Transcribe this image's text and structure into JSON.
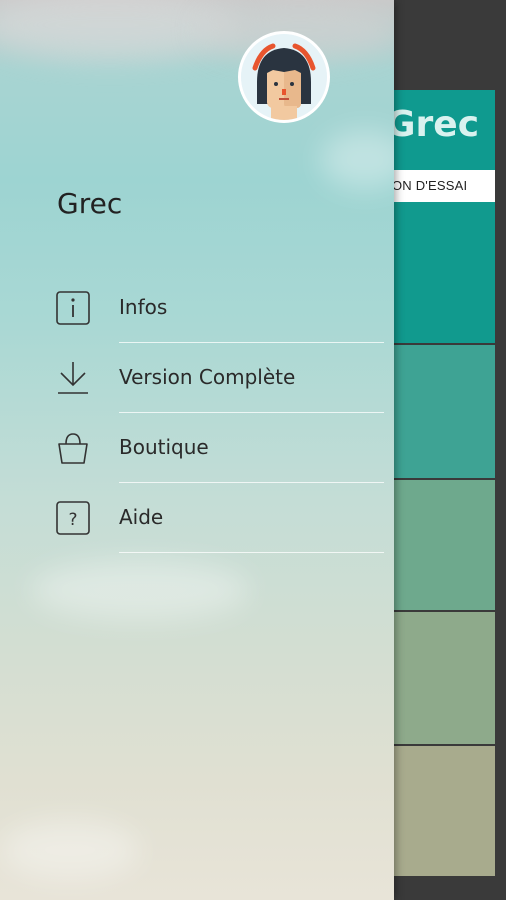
{
  "background_app": {
    "title": "Grec",
    "trial_label": "ON D'ESSAI"
  },
  "drawer": {
    "title": "Grec",
    "avatar_icon": "girl-avatar-icon",
    "menu": [
      {
        "label": "Infos",
        "icon": "info-icon"
      },
      {
        "label": "Version Complète",
        "icon": "download-icon"
      },
      {
        "label": "Boutique",
        "icon": "shopping-bag-icon"
      },
      {
        "label": "Aide",
        "icon": "help-icon"
      }
    ]
  },
  "colors": {
    "teal": "#0f9a8f",
    "text": "#2a2a2a"
  }
}
